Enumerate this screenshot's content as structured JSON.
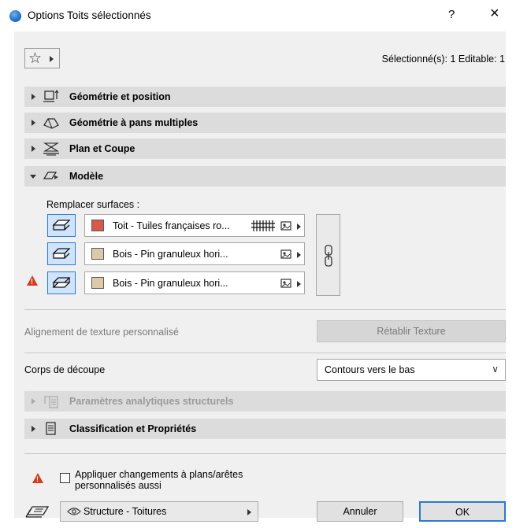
{
  "window": {
    "title": "Options Toits sélectionnés",
    "help_label": "?",
    "close_label": "×"
  },
  "header": {
    "selection_info": "Sélectionné(s): 1 Editable: 1"
  },
  "sections": [
    {
      "label": "Géométrie et position",
      "expanded": false,
      "enabled": true,
      "icon": "geometry-position-icon"
    },
    {
      "label": "Géométrie à pans multiples",
      "expanded": false,
      "enabled": true,
      "icon": "multi-plane-roof-icon"
    },
    {
      "label": "Plan et Coupe",
      "expanded": false,
      "enabled": true,
      "icon": "floor-plan-section-icon"
    },
    {
      "label": "Modèle",
      "expanded": true,
      "enabled": true,
      "icon": "model-icon"
    }
  ],
  "model": {
    "override_label": "Remplacer surfaces :",
    "surfaces": [
      {
        "name": "Toit - Tuiles françaises ro...",
        "color": "#d9584a",
        "icon": "roof-top-surface-icon",
        "has_tiles_icon": true,
        "warning": false
      },
      {
        "name": "Bois - Pin granuleux hori...",
        "color": "#dcc9a7",
        "icon": "roof-edge-surface-icon",
        "has_tiles_icon": false,
        "warning": false
      },
      {
        "name": "Bois - Pin granuleux hori...",
        "color": "#dcc9a7",
        "icon": "roof-bottom-surface-icon",
        "has_tiles_icon": false,
        "warning": true
      }
    ],
    "texture_alignment_label": "Alignement de texture personnalisé",
    "reset_texture_label": "Rétablir Texture"
  },
  "trim": {
    "label": "Corps de découpe",
    "selected": "Contours vers le bas"
  },
  "lower_sections": [
    {
      "label": "Paramètres analytiques structurels",
      "enabled": false,
      "icon": "structural-analytics-icon"
    },
    {
      "label": "Classification et Propriétés",
      "enabled": true,
      "icon": "classification-icon"
    }
  ],
  "footer": {
    "apply_label_line1": "Appliquer changements à plans/arêtes",
    "apply_label_line2": "personnalisés aussi",
    "apply_checked": false,
    "layer_label": "Structure - Toitures",
    "cancel_label": "Annuler",
    "ok_label": "OK"
  },
  "colors": {
    "accent": "#2a7bd4",
    "warning": "#d53a1c",
    "section_bg": "#dcdcdc"
  }
}
